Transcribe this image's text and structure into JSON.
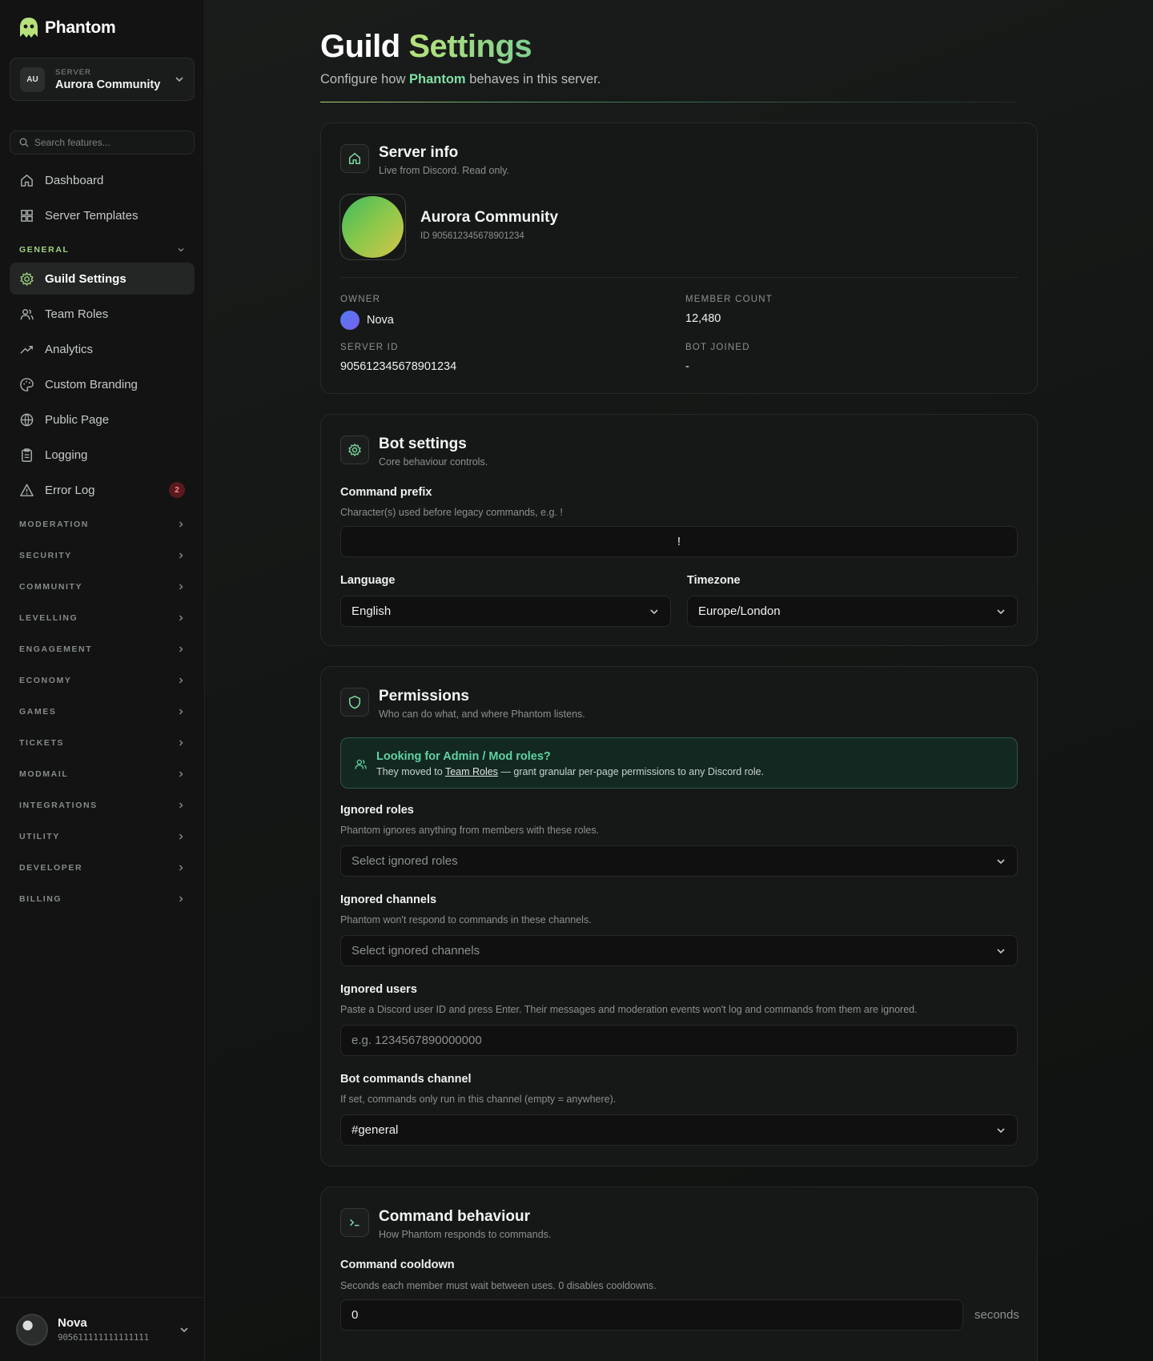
{
  "brand": {
    "name": "Phantom"
  },
  "server_picker": {
    "avatar_text": "AU",
    "kicker": "SERVER",
    "name": "Aurora Community"
  },
  "search": {
    "placeholder": "Search features..."
  },
  "nav": {
    "top": [
      {
        "label": "Dashboard",
        "icon": "home-icon"
      },
      {
        "label": "Server Templates",
        "icon": "grid-icon"
      }
    ],
    "general_heading": "GENERAL",
    "general_items": [
      {
        "label": "Guild Settings",
        "icon": "gear-icon",
        "active": true
      },
      {
        "label": "Team Roles",
        "icon": "users-icon"
      },
      {
        "label": "Analytics",
        "icon": "trend-icon"
      },
      {
        "label": "Custom Branding",
        "icon": "palette-icon"
      },
      {
        "label": "Public Page",
        "icon": "globe-icon"
      },
      {
        "label": "Logging",
        "icon": "clipboard-icon"
      },
      {
        "label": "Error Log",
        "icon": "warning-icon",
        "badge": "2"
      }
    ],
    "sections": [
      "MODERATION",
      "SECURITY",
      "COMMUNITY",
      "LEVELLING",
      "ENGAGEMENT",
      "ECONOMY",
      "GAMES",
      "TICKETS",
      "MODMAIL",
      "INTEGRATIONS",
      "UTILITY",
      "DEVELOPER",
      "BILLING"
    ]
  },
  "user": {
    "name": "Nova",
    "id": "905611111111111111"
  },
  "page": {
    "title_main": "Guild",
    "title_accent": "Settings",
    "subtitle_pre": "Configure how",
    "subtitle_brand": "Phantom",
    "subtitle_post": "behaves in this server."
  },
  "server_info": {
    "title": "Server info",
    "subtitle": "Live from Discord. Read only.",
    "server_name": "Aurora Community",
    "server_id_line": "ID 905612345678901234",
    "owner_label": "OWNER",
    "owner_value": "Nova",
    "member_count_label": "MEMBER COUNT",
    "member_count_value": "12,480",
    "server_id_label": "SERVER ID",
    "server_id_value": "905612345678901234",
    "bot_joined_label": "BOT JOINED",
    "bot_joined_value": "-"
  },
  "bot_settings": {
    "title": "Bot settings",
    "subtitle": "Core behaviour controls.",
    "prefix_label": "Command prefix",
    "prefix_help": "Character(s) used before legacy commands, e.g. !",
    "prefix_value": "!",
    "language_label": "Language",
    "language_value": "English",
    "timezone_label": "Timezone",
    "timezone_value": "Europe/London"
  },
  "permissions": {
    "title": "Permissions",
    "subtitle": "Who can do what, and where Phantom listens.",
    "notice_title": "Looking for Admin / Mod roles?",
    "notice_pre": "They moved to",
    "notice_link": "Team Roles",
    "notice_post": "— grant granular per-page permissions to any Discord role.",
    "ignored_roles_label": "Ignored roles",
    "ignored_roles_help": "Phantom ignores anything from members with these roles.",
    "ignored_roles_placeholder": "Select ignored roles",
    "ignored_channels_label": "Ignored channels",
    "ignored_channels_help": "Phantom won't respond to commands in these channels.",
    "ignored_channels_placeholder": "Select ignored channels",
    "ignored_users_label": "Ignored users",
    "ignored_users_help": "Paste a Discord user ID and press Enter. Their messages and moderation events won't log and commands from them are ignored.",
    "ignored_users_placeholder": "e.g. 1234567890000000",
    "bot_channel_label": "Bot commands channel",
    "bot_channel_help": "If set, commands only run in this channel (empty = anywhere).",
    "bot_channel_value": "#general"
  },
  "command_behaviour": {
    "title": "Command behaviour",
    "subtitle": "How Phantom responds to commands.",
    "cooldown_label": "Command cooldown",
    "cooldown_help": "Seconds each member must wait between uses. 0 disables cooldowns.",
    "cooldown_value": "0",
    "cooldown_unit": "seconds"
  },
  "colors": {
    "accent": "#9fd37f",
    "brand_green": "#7fe0a4",
    "notice_green": "#5fd4a1",
    "badge_red": "#5a1a1d"
  }
}
